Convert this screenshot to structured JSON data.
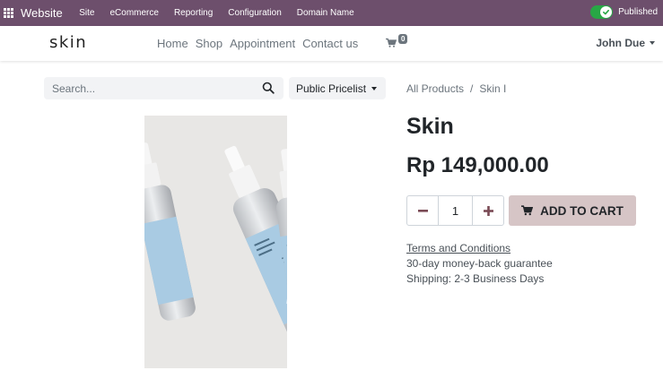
{
  "admin_bar": {
    "brand": "Website",
    "menu": [
      "Site",
      "eCommerce",
      "Reporting",
      "Configuration",
      "Domain Name"
    ],
    "status": "Published"
  },
  "header": {
    "logo": "skin",
    "nav": [
      "Home",
      "Shop",
      "Appointment",
      "Contact us"
    ],
    "cart_count": "0",
    "user": "John Due"
  },
  "toolbar": {
    "search_placeholder": "Search...",
    "pricelist": "Public Pricelist",
    "breadcrumb": {
      "parent": "All Products",
      "separator": "/",
      "current": "Skin I"
    }
  },
  "product": {
    "name": "Skin",
    "price": "Rp 149,000.00",
    "quantity": "1",
    "add_to_cart": "ADD TO CART",
    "terms": "Terms and Conditions",
    "guarantee": "30-day money-back guarantee",
    "shipping": "Shipping: 2-3 Business Days"
  },
  "colors": {
    "admin_bar": "#6d4f6c",
    "published_toggle": "#28a745",
    "add_to_cart_bg": "#d6c5c6",
    "serum_label": "#a9cbe3"
  }
}
